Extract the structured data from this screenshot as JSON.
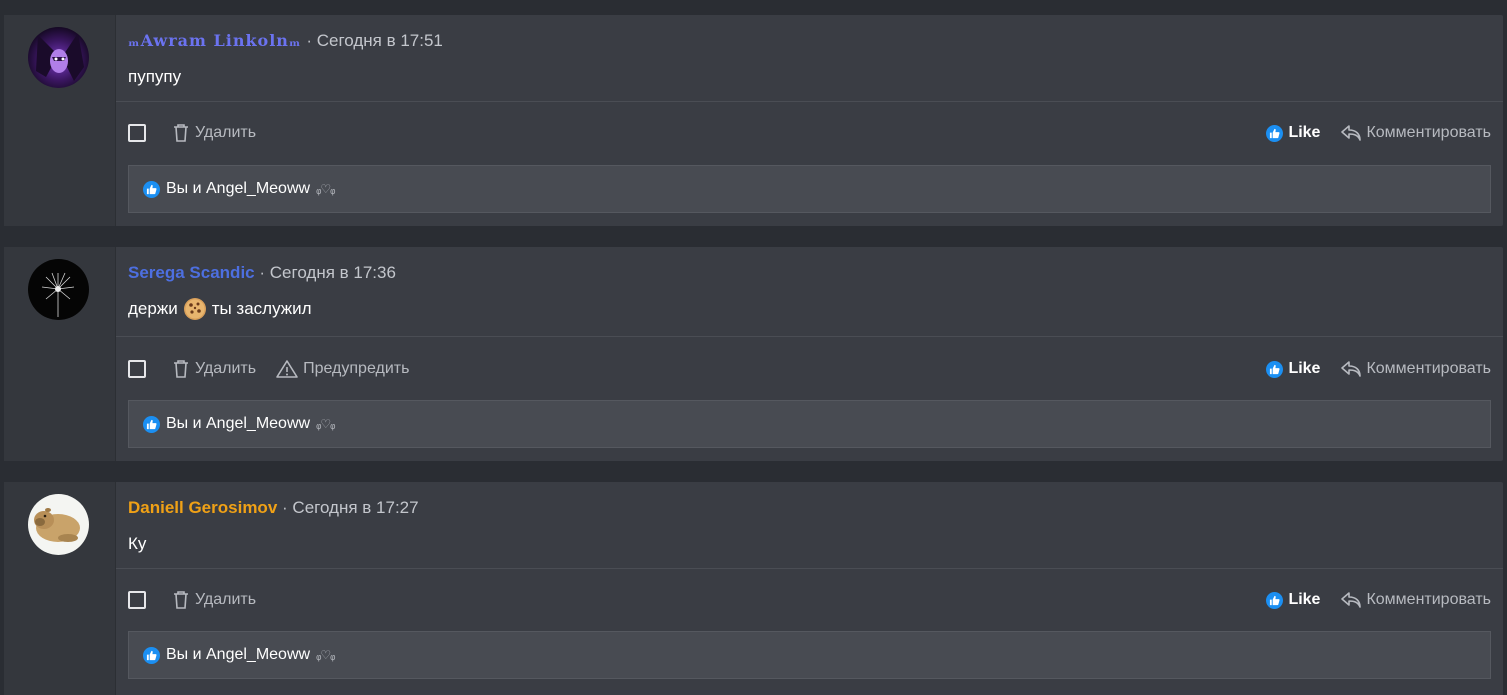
{
  "posts": [
    {
      "author": "ₘAwram Linkolnₘ",
      "author_display": "Awram Linkoln",
      "author_color": "#6b73f0",
      "separator": "·",
      "time": "Сегодня в 17:51",
      "text": "пупупу",
      "actions": {
        "delete": "Удалить"
      },
      "like_label": "Like",
      "comment_label": "Комментировать",
      "likes_text": "Вы и Angel_Meoww",
      "likes_deco": "ᵩ♡ᵩ",
      "avatar_icon": "avatar-purple-character"
    },
    {
      "author": "Serega Scandic",
      "author_color": "#4d6fe0",
      "separator": "·",
      "time": "Сегодня в 17:36",
      "text_before": "держи",
      "text_emoji": "cookie-emoji",
      "text_after": "ты заслужил",
      "actions": {
        "delete": "Удалить",
        "warn": "Предупредить"
      },
      "like_label": "Like",
      "comment_label": "Комментировать",
      "likes_text": "Вы и Angel_Meoww",
      "likes_deco": "ᵩ♡ᵩ",
      "avatar_icon": "avatar-dandelion"
    },
    {
      "author": "Daniell Gerosimov",
      "author_color": "#f0a116",
      "separator": "·",
      "time": "Сегодня в 17:27",
      "text": "Ку",
      "actions": {
        "delete": "Удалить"
      },
      "like_label": "Like",
      "comment_label": "Комментировать",
      "likes_text": "Вы и Angel_Meoww",
      "likes_deco": "ᵩ♡ᵩ",
      "avatar_icon": "avatar-capybara"
    }
  ],
  "colors": {
    "background": "#2a2d33",
    "card": "#3a3d44",
    "like_blue": "#1b8ff2"
  }
}
